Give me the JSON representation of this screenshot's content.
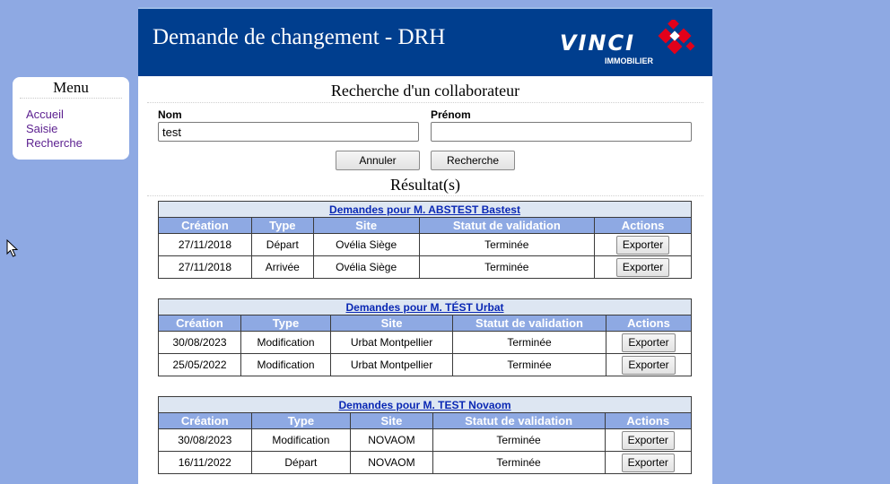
{
  "menu": {
    "title": "Menu",
    "items": [
      {
        "label": "Accueil"
      },
      {
        "label": "Saisie"
      },
      {
        "label": "Recherche"
      }
    ]
  },
  "header": {
    "title": "Demande de changement - DRH",
    "logo_text": "VINCI",
    "logo_subtext": "IMMOBILIER"
  },
  "search": {
    "title": "Recherche d'un collaborateur",
    "nom_label": "Nom",
    "nom_value": "test",
    "prenom_label": "Prénom",
    "prenom_value": "",
    "cancel_label": "Annuler",
    "search_label": "Recherche"
  },
  "results": {
    "title": "Résultat(s)",
    "columns": [
      "Création",
      "Type",
      "Site",
      "Statut de validation",
      "Actions"
    ],
    "export_label": "Exporter",
    "groups": [
      {
        "caption": "Demandes pour M. ABSTEST Bastest",
        "rows": [
          {
            "creation": "27/11/2018",
            "type": "Départ",
            "site": "Ovélia Siège",
            "statut": "Terminée"
          },
          {
            "creation": "27/11/2018",
            "type": "Arrivée",
            "site": "Ovélia Siège",
            "statut": "Terminée"
          }
        ]
      },
      {
        "caption": "Demandes pour M. TÉST Urbat",
        "rows": [
          {
            "creation": "30/08/2023",
            "type": "Modification",
            "site": "Urbat Montpellier",
            "statut": "Terminée"
          },
          {
            "creation": "25/05/2022",
            "type": "Modification",
            "site": "Urbat Montpellier",
            "statut": "Terminée"
          }
        ]
      },
      {
        "caption": "Demandes pour M. TEST Novaom",
        "rows": [
          {
            "creation": "30/08/2023",
            "type": "Modification",
            "site": "NOVAOM",
            "statut": "Terminée"
          },
          {
            "creation": "16/11/2022",
            "type": "Départ",
            "site": "NOVAOM",
            "statut": "Terminée"
          }
        ]
      }
    ]
  },
  "colors": {
    "background": "#8ea9e3",
    "header": "#003e8e",
    "logo_accent": "#e2001a",
    "table_header": "#8ea9e3",
    "caption_bg": "#dde6f2",
    "link": "#0a28b4"
  }
}
